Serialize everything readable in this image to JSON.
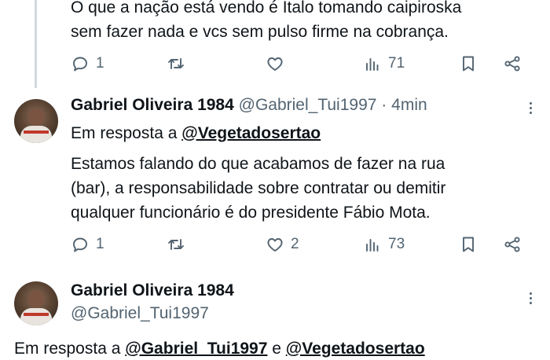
{
  "tweet1": {
    "text_line1": "O que a nação está vendo é Ítalo tomando caipiroska",
    "text_line2": "sem fazer nada e vcs sem pulso firme na cobrança.",
    "actions": {
      "replies": "1",
      "retweets": "",
      "likes": "",
      "views": "71"
    }
  },
  "tweet2": {
    "display_name": "Gabriel Oliveira 1984",
    "handle": "@Gabriel_Tui1997",
    "separator": "·",
    "time": "4min",
    "reply_prefix": "Em resposta a",
    "reply_to": "@Vegetadosertao",
    "text_line1": "Estamos falando do que acabamos de fazer na rua",
    "text_line2": "(bar), a responsabilidade sobre contratar ou demitir",
    "text_line3": "qualquer funcionário é do presidente Fábio Mota.",
    "actions": {
      "replies": "1",
      "retweets": "",
      "likes": "2",
      "views": "73"
    }
  },
  "tweet3": {
    "display_name": "Gabriel Oliveira 1984",
    "handle": "@Gabriel_Tui1997",
    "reply_prefix": "Em resposta a",
    "reply_to_1": "@Gabriel_Tui1997",
    "reply_conj": "e",
    "reply_to_2": "@Vegetadosertao"
  },
  "icons": [
    "reply-icon",
    "retweet-icon",
    "like-icon",
    "views-icon",
    "bookmark-icon",
    "share-icon",
    "more-icon"
  ],
  "colors": {
    "text": "#0f1419",
    "secondary": "#536471",
    "thread_line": "#cfd9de",
    "background": "#ffffff"
  }
}
